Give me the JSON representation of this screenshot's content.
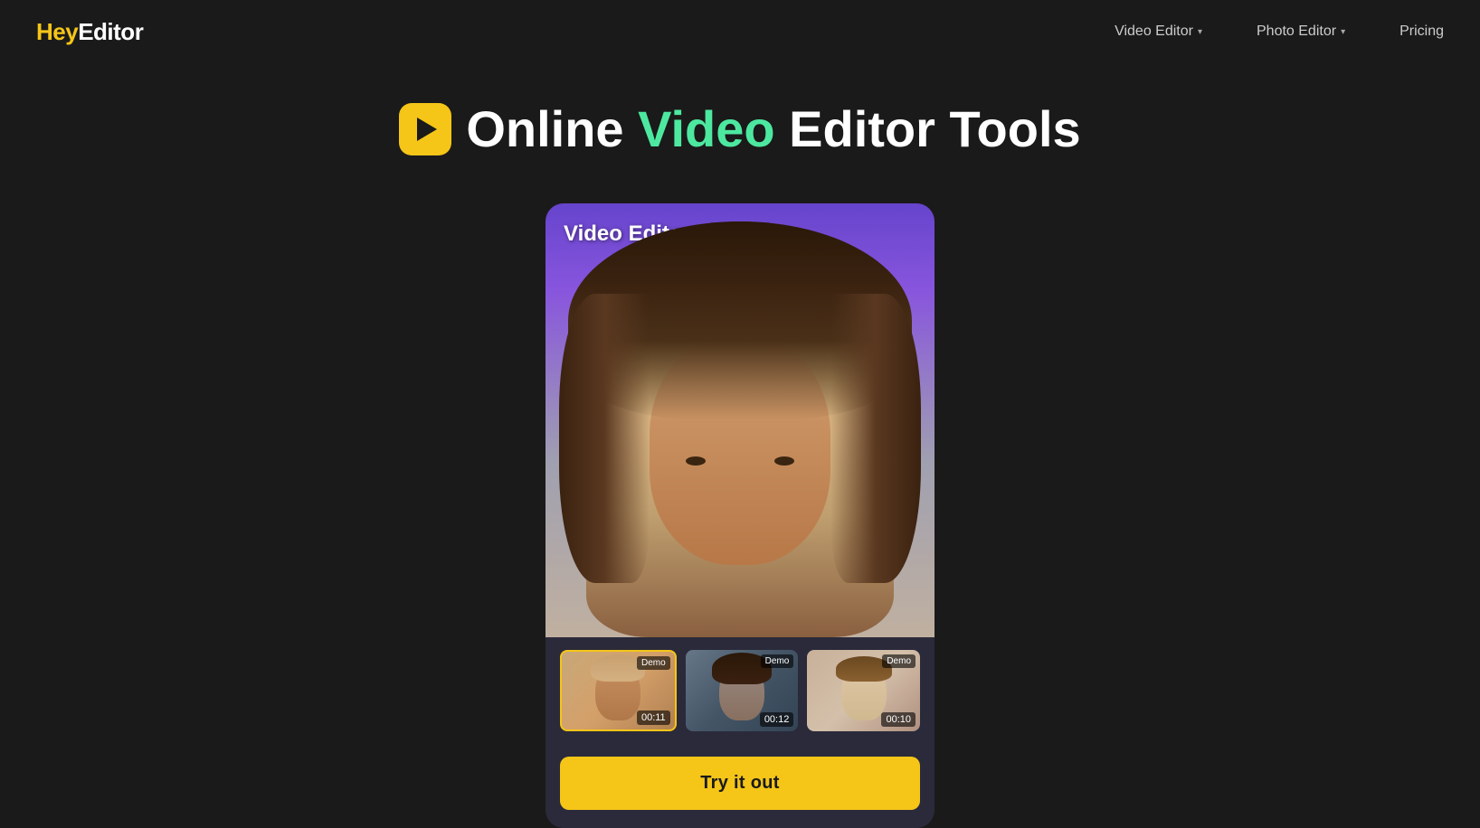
{
  "logo": {
    "hey": "Hey",
    "editor": "Editor"
  },
  "nav": {
    "links": [
      {
        "id": "video-editor",
        "label": "Video Editor",
        "hasDropdown": true
      },
      {
        "id": "photo-editor",
        "label": "Photo Editor",
        "hasDropdown": true
      },
      {
        "id": "pricing",
        "label": "Pricing",
        "hasDropdown": false
      }
    ]
  },
  "hero": {
    "title_part1": "Online ",
    "title_video": "Video",
    "title_part2": " Editor Tools"
  },
  "card": {
    "label": "Video Editor",
    "thumbnails": [
      {
        "id": "thumb-1",
        "demo": "Demo",
        "time": "00:11",
        "active": true
      },
      {
        "id": "thumb-2",
        "demo": "Demo",
        "time": "00:12",
        "active": false
      },
      {
        "id": "thumb-3",
        "demo": "Demo",
        "time": "00:10",
        "active": false
      }
    ],
    "try_button": "Try it out"
  },
  "colors": {
    "brand_yellow": "#f5c518",
    "brand_green": "#4de8a0",
    "bg_dark": "#1a1a1a",
    "card_bg": "#2a2a3a"
  }
}
